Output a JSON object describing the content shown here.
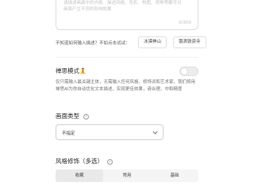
{
  "prompt": {
    "placeholder": "请描述画面中的内容、描述风格、色彩、构图、视角等都可对画面产生不同的影响效果",
    "counter": "0/300"
  },
  "hint": {
    "text": "不知道如何输入描述？不如点击试试：",
    "chips": [
      "冰漠神山",
      "饿滴铁资寺"
    ]
  },
  "zen_mode": {
    "title": "禅思模式",
    "emoji": "🧘",
    "enabled": false,
    "description": "仅只需输入最关键主体，无需输入任何风格、修饰词和艺术家，我们将用禅思AI为你自动优化文本描述，实现更佳效果，请合理，中和精度"
  },
  "canvas_type": {
    "title": "画面类型",
    "info_icon": "ⓘ",
    "selected": "不指定"
  },
  "style_modifiers": {
    "title": "风格修饰（多选）",
    "info_icon": "ⓘ",
    "tabs": [
      "收藏",
      "常用",
      "基础"
    ]
  }
}
